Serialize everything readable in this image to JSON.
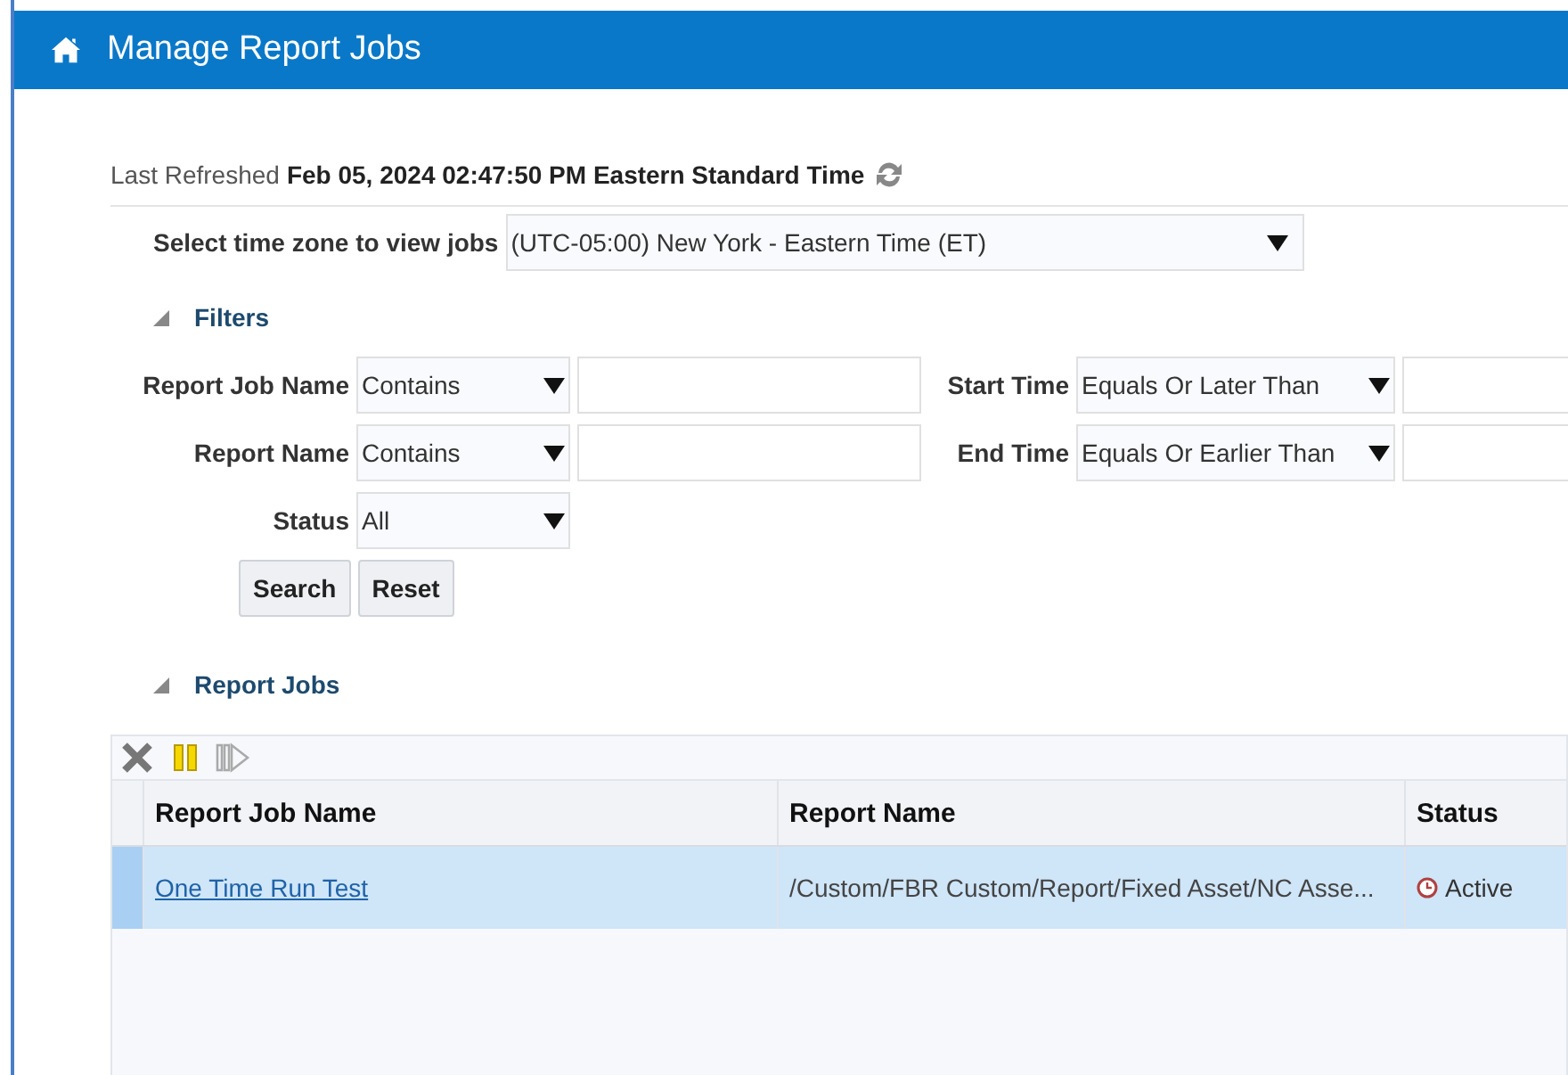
{
  "header": {
    "title": "Manage Report Jobs"
  },
  "refresh": {
    "label": "Last Refreshed",
    "value": "Feb 05, 2024 02:47:50 PM Eastern Standard Time"
  },
  "timezone": {
    "label": "Select time zone to view jobs",
    "value": "(UTC-05:00) New York - Eastern Time (ET)"
  },
  "filters": {
    "title": "Filters",
    "expanded": true,
    "fields": [
      {
        "label": "Report Job Name",
        "operator": "Contains"
      },
      {
        "label": "Start Time",
        "operator": "Equals Or Later Than"
      },
      {
        "label": "Report Name",
        "operator": "Contains"
      },
      {
        "label": "End Time",
        "operator": "Equals Or Earlier Than"
      }
    ],
    "status": {
      "label": "Status",
      "value": "All"
    },
    "buttons": [
      "Search",
      "Reset"
    ]
  },
  "report_jobs": {
    "title": "Report Jobs",
    "expanded": true,
    "toolbar": [
      {
        "kind": "delete",
        "disabled": false
      },
      {
        "kind": "pause",
        "disabled": false
      },
      {
        "kind": "resume",
        "disabled": true
      }
    ],
    "columns": [
      "Report Job Name",
      "Report Name",
      "Status"
    ],
    "rows": [
      {
        "job_name": "One Time Run Test",
        "report_name": "/Custom/FBR Custom/Report/Fixed Asset/NC Asse...",
        "status": "Active",
        "selected": true
      }
    ]
  }
}
